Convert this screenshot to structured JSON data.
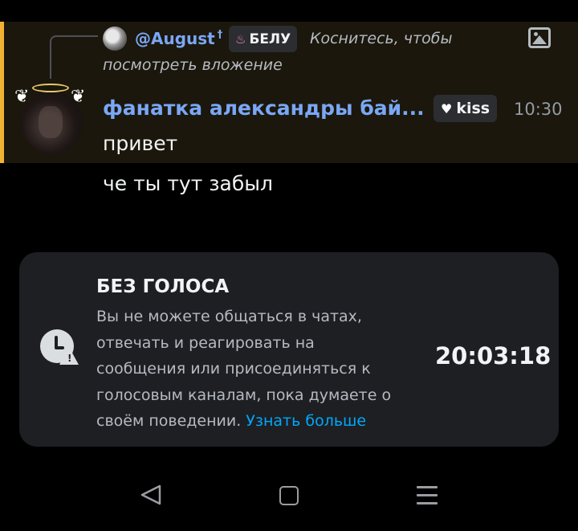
{
  "reply": {
    "author": "@August",
    "author_mark": "†",
    "tag_icon": "flame-icon",
    "tag_label": "БЕЛУ",
    "text_line1": "Коснитесь, чтобы",
    "text_line2": "посмотреть вложение",
    "attachment_icon": "image-icon"
  },
  "message": {
    "author": "фанатка александры бай...",
    "badge_icon": "heart-icon",
    "badge_label": "kiss",
    "time": "10:30",
    "lines": [
      "привет",
      "че ты тут забыл"
    ],
    "highlight_color": "#f0b232"
  },
  "mute_notice": {
    "icon": "clock-warning-icon",
    "title": "БЕЗ ГОЛОСА",
    "text_line1": "Вы не можете общаться в чатах,",
    "text_line2": "отвечать и реагировать на",
    "text_line3": "сообщения или присоединяться к",
    "text_line4": "голосовым каналам, пока думаете о",
    "text_line5": "своём поведении.",
    "link": "Узнать больше",
    "timer": "20:03:18",
    "link_color": "#00a8fc"
  },
  "navbar": {
    "back_icon": "back-triangle-icon",
    "home_icon": "home-square-icon",
    "menu_icon": "recent-apps-icon"
  }
}
